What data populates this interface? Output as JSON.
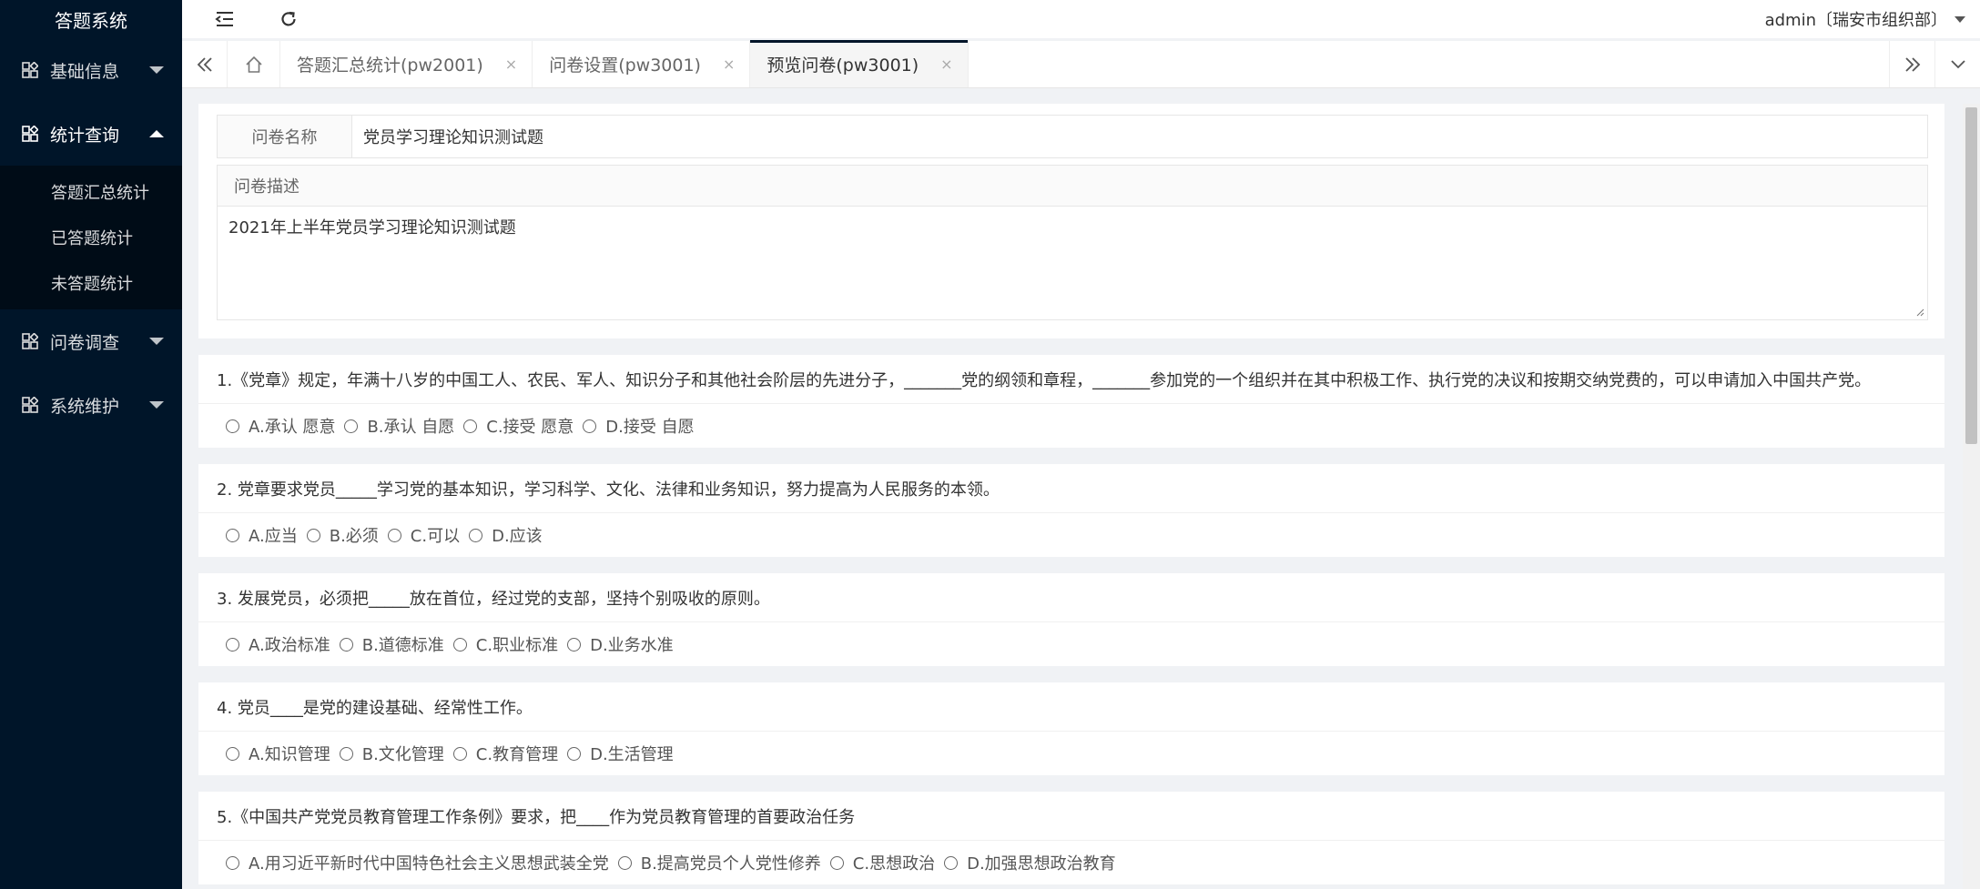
{
  "app": {
    "title": "答题系统"
  },
  "sidebar": {
    "menus": [
      {
        "label": "基础信息",
        "icon": "grid-icon",
        "open": false
      },
      {
        "label": "统计查询",
        "icon": "grid-icon",
        "open": true,
        "children": [
          "答题汇总统计",
          "已答题统计",
          "未答题统计"
        ]
      },
      {
        "label": "问卷调查",
        "icon": "grid-icon",
        "open": false
      },
      {
        "label": "系统维护",
        "icon": "grid-icon",
        "open": false
      }
    ]
  },
  "header": {
    "user": "admin〔瑞安市组织部〕"
  },
  "tabs": [
    {
      "label": "答题汇总统计(pw2001)",
      "active": false
    },
    {
      "label": "问卷设置(pw3001)",
      "active": false
    },
    {
      "label": "预览问卷(pw3001)",
      "active": true
    }
  ],
  "tab_close_glyph": "×",
  "form": {
    "name_label": "问卷名称",
    "name_value": "党员学习理论知识测试题",
    "desc_label": "问卷描述",
    "desc_value": "2021年上半年党员学习理论知识测试题"
  },
  "questions": [
    {
      "title": "1.《党章》规定，年满十八岁的中国工人、农民、军人、知识分子和其他社会阶层的先进分子，_______党的纲领和章程，_______参加党的一个组织并在其中积极工作、执行党的决议和按期交纳党费的，可以申请加入中国共产党。",
      "options": [
        "A.承认 愿意",
        "B.承认 自愿",
        "C.接受 愿意",
        "D.接受 自愿"
      ]
    },
    {
      "title": "2. 党章要求党员_____学习党的基本知识，学习科学、文化、法律和业务知识，努力提高为人民服务的本领。",
      "options": [
        "A.应当",
        "B.必须",
        "C.可以",
        "D.应该"
      ]
    },
    {
      "title": "3. 发展党员，必须把_____放在首位，经过党的支部，坚持个别吸收的原则。",
      "options": [
        "A.政治标准",
        "B.道德标准",
        "C.职业标准",
        "D.业务水准"
      ]
    },
    {
      "title": "4. 党员____是党的建设基础、经常性工作。",
      "options": [
        "A.知识管理",
        "B.文化管理",
        "C.教育管理",
        "D.生活管理"
      ]
    },
    {
      "title": "5.《中国共产党党员教育管理工作条例》要求，把____作为党员教育管理的首要政治任务",
      "options": [
        "A.用习近平新时代中国特色社会主义思想武装全党",
        "B.提高党员个人党性修养",
        "C.思想政治",
        "D.加强思想政治教育"
      ]
    }
  ],
  "colors": {
    "sidebar_bg": "#001529",
    "submenu_bg": "#000c17",
    "page_bg": "#f0f2f5"
  }
}
